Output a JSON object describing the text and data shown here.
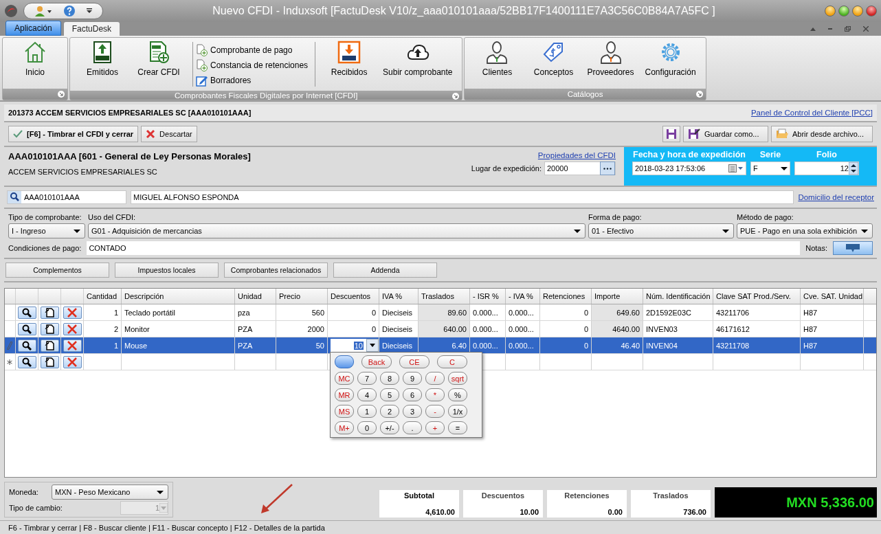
{
  "window": {
    "title": "Nuevo CFDI - Induxsoft [FactuDesk V10/z_aaa010101aaa/52BB17F1400111E7A3C56C0B84A7A5FC ]"
  },
  "ribbon_tabs": [
    {
      "label": "Aplicación",
      "selected": false,
      "kind": "app"
    },
    {
      "label": "FactuDesk",
      "selected": true,
      "kind": "tab"
    }
  ],
  "ribbon_groups": [
    {
      "items": [
        {
          "kind": "large",
          "label": "Inicio"
        }
      ]
    },
    {
      "caption": "Comprobantes Fiscales Digitales por Internet [CFDI]",
      "items": [
        {
          "kind": "large",
          "label": "Emitidos"
        },
        {
          "kind": "large",
          "label": "Crear CFDI"
        },
        {
          "kind": "stack",
          "items": [
            "Comprobante de pago",
            "Constancia de retenciones",
            "Borradores"
          ]
        },
        {
          "kind": "large",
          "label": "Recibidos"
        },
        {
          "kind": "large",
          "label": "Subir comprobante"
        }
      ]
    },
    {
      "caption": "Catálogos",
      "items": [
        {
          "kind": "large",
          "label": "Clientes"
        },
        {
          "kind": "large",
          "label": "Conceptos"
        },
        {
          "kind": "large",
          "label": "Proveedores"
        },
        {
          "kind": "large",
          "label": "Configuración"
        }
      ]
    }
  ],
  "client_bar": {
    "title": "201373 ACCEM SERVICIOS EMPRESARIALES SC [AAA010101AAA]",
    "link": "Panel de Control del Cliente [PCC]"
  },
  "actions": {
    "left": [
      "[F6] - Timbrar el CFDI y cerrar",
      "Descartar"
    ],
    "right": [
      "Guardar como...",
      "Abrir desde archivo..."
    ]
  },
  "emitter": {
    "rfc_line": "AAA010101AAA [601 - General de Ley Personas Morales]",
    "name": "ACCEM SERVICIOS EMPRESARIALES SC",
    "link": "Propiedades del CFDI",
    "place_label": "Lugar de expedición:",
    "place_value": "20000"
  },
  "expedition": {
    "date_label": "Fecha y hora de expedición",
    "date_value": "2018-03-23 17:53:06",
    "series_label": "Serie",
    "series_value": "F",
    "folio_label": "Folio",
    "folio_value": "12"
  },
  "receiver": {
    "rfc": "AAA010101AAA",
    "name": "MIGUEL ALFONSO ESPONDA",
    "link": "Domicilio del receptor"
  },
  "combos": [
    {
      "label": "Tipo de comprobante:",
      "value": "I - Ingreso"
    },
    {
      "label": "Uso del CFDI:",
      "value": "G01 - Adquisición de mercancias"
    },
    {
      "label": "Forma de pago:",
      "value": "01 - Efectivo"
    },
    {
      "label": "Método de pago:",
      "value": "PUE - Pago en una sola exhibición"
    }
  ],
  "payment_terms": {
    "label": "Condiciones de pago:",
    "value": "CONTADO"
  },
  "notes_label": "Notas:",
  "section_buttons": [
    "Complementos",
    "Impuestos locales",
    "Comprobantes relacionados",
    "Addenda"
  ],
  "table": {
    "columns": [
      {
        "label": "Cantidad",
        "numeric": true,
        "readonly": false
      },
      {
        "label": "Descripción",
        "numeric": false,
        "readonly": false
      },
      {
        "label": "Unidad",
        "numeric": false,
        "readonly": false
      },
      {
        "label": "Precio",
        "numeric": true,
        "readonly": false
      },
      {
        "label": "Descuentos",
        "numeric": true,
        "readonly": false
      },
      {
        "label": "IVA %",
        "numeric": false,
        "readonly": false
      },
      {
        "label": "Traslados",
        "numeric": true,
        "readonly": true
      },
      {
        "label": "- ISR %",
        "numeric": false,
        "readonly": false
      },
      {
        "label": "- IVA %",
        "numeric": false,
        "readonly": false
      },
      {
        "label": "Retenciones",
        "numeric": true,
        "readonly": false
      },
      {
        "label": "Importe",
        "numeric": true,
        "readonly": true
      },
      {
        "label": "Núm. Identificación",
        "numeric": false,
        "readonly": false
      },
      {
        "label": "Clave SAT Prod./Serv.",
        "numeric": false,
        "readonly": false
      },
      {
        "label": "Cve. SAT. Unidad",
        "numeric": false,
        "readonly": false
      }
    ],
    "rows": [
      {
        "selected": false,
        "kind": "normal",
        "cells": [
          "1",
          "Teclado portátil",
          "pza",
          "560",
          "0",
          "Dieciseis",
          "89.60",
          "0.000...",
          "0.000...",
          "0",
          "649.60",
          "2D1592E03C",
          "43211706",
          "H87"
        ]
      },
      {
        "selected": false,
        "kind": "normal",
        "cells": [
          "2",
          "Monitor",
          "PZA",
          "2000",
          "0",
          "Dieciseis",
          "640.00",
          "0.000...",
          "0.000...",
          "0",
          "4640.00",
          "INVEN03",
          "46171612",
          "H87"
        ]
      },
      {
        "selected": true,
        "kind": "edit",
        "cells": [
          "1",
          "Mouse",
          "PZA",
          "50",
          {
            "value": "10",
            "editing": true
          },
          "Dieciseis",
          "6.40",
          "0.000...",
          "0.000...",
          "0",
          "46.40",
          "INVEN04",
          "43211708",
          "H87"
        ]
      },
      {
        "selected": false,
        "kind": "new",
        "cells": []
      }
    ]
  },
  "calculator": [
    [
      {
        "kind": "blank"
      },
      {
        "kind": "wide",
        "label": "Back"
      },
      {
        "kind": "wide",
        "label": "CE"
      },
      {
        "kind": "wide",
        "label": "C"
      }
    ],
    [
      {
        "kind": "memory",
        "label": "MC"
      },
      {
        "kind": "digit",
        "label": "7"
      },
      {
        "kind": "digit",
        "label": "8"
      },
      {
        "kind": "digit",
        "label": "9"
      },
      {
        "kind": "op",
        "label": "/"
      },
      {
        "kind": "op",
        "label": "sqrt"
      }
    ],
    [
      {
        "kind": "memory",
        "label": "MR"
      },
      {
        "kind": "digit",
        "label": "4"
      },
      {
        "kind": "digit",
        "label": "5"
      },
      {
        "kind": "digit",
        "label": "6"
      },
      {
        "kind": "op",
        "label": "*"
      },
      {
        "kind": "digit",
        "label": "%"
      }
    ],
    [
      {
        "kind": "memory",
        "label": "MS"
      },
      {
        "kind": "digit",
        "label": "1"
      },
      {
        "kind": "digit",
        "label": "2"
      },
      {
        "kind": "digit",
        "label": "3"
      },
      {
        "kind": "op",
        "label": "-"
      },
      {
        "kind": "digit",
        "label": "1/x"
      }
    ],
    [
      {
        "kind": "memory",
        "label": "M+"
      },
      {
        "kind": "digit",
        "label": "0"
      },
      {
        "kind": "digit",
        "label": "+/-"
      },
      {
        "kind": "digit",
        "label": "."
      },
      {
        "kind": "op",
        "label": "+"
      },
      {
        "kind": "digit",
        "label": "="
      }
    ]
  ],
  "currency": {
    "label": "Moneda:",
    "value": "MXN - Peso Mexicano",
    "rate_label": "Tipo de cambio:",
    "rate_value": "1",
    "rate_disabled": true
  },
  "totals": [
    {
      "label": "Subtotal",
      "value": "4,610.00",
      "bold": true
    },
    {
      "label": "Descuentos",
      "value": "10.00",
      "bold": false
    },
    {
      "label": "Retenciones",
      "value": "0.00",
      "bold": false
    },
    {
      "label": "Traslados",
      "value": "736.00",
      "bold": false
    }
  ],
  "grand_total": "MXN 5,336.00",
  "status_bar": "F6 - Timbrar y cerrar | F8 - Buscar cliente | F11 - Buscar concepto | F12 - Detalles de la partida"
}
